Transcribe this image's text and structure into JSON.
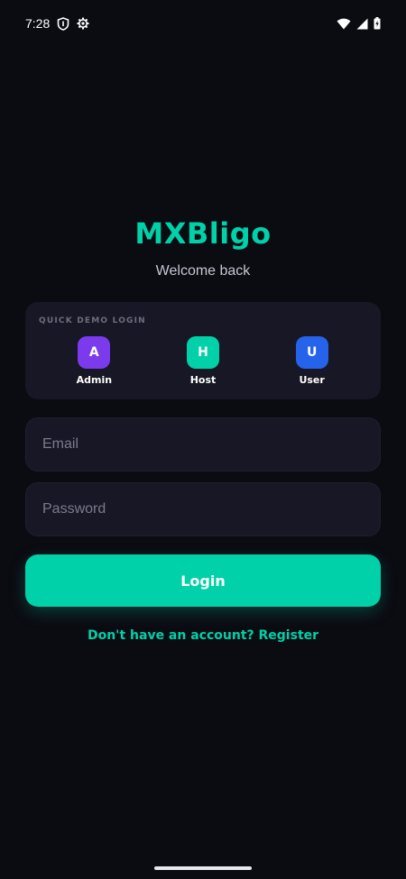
{
  "status_bar": {
    "time": "7:28",
    "icons": [
      "shield-icon",
      "settings-gear-icon",
      "wifi-icon",
      "signal-icon",
      "battery-icon"
    ]
  },
  "brand": {
    "title": "MXBligo",
    "subtitle": "Welcome back"
  },
  "quick_demo": {
    "title": "QUICK DEMO LOGIN",
    "options": [
      {
        "initial": "A",
        "label": "Admin",
        "color": "#7c3aed"
      },
      {
        "initial": "H",
        "label": "Host",
        "color": "#00d1a8"
      },
      {
        "initial": "U",
        "label": "User",
        "color": "#2563eb"
      }
    ]
  },
  "form": {
    "email_placeholder": "Email",
    "email_value": "",
    "password_placeholder": "Password",
    "password_value": "",
    "login_label": "Login",
    "register_link": "Don't have an account? Register"
  },
  "colors": {
    "accent": "#00d1a8",
    "background": "#0b0b12",
    "card": "#171725"
  }
}
